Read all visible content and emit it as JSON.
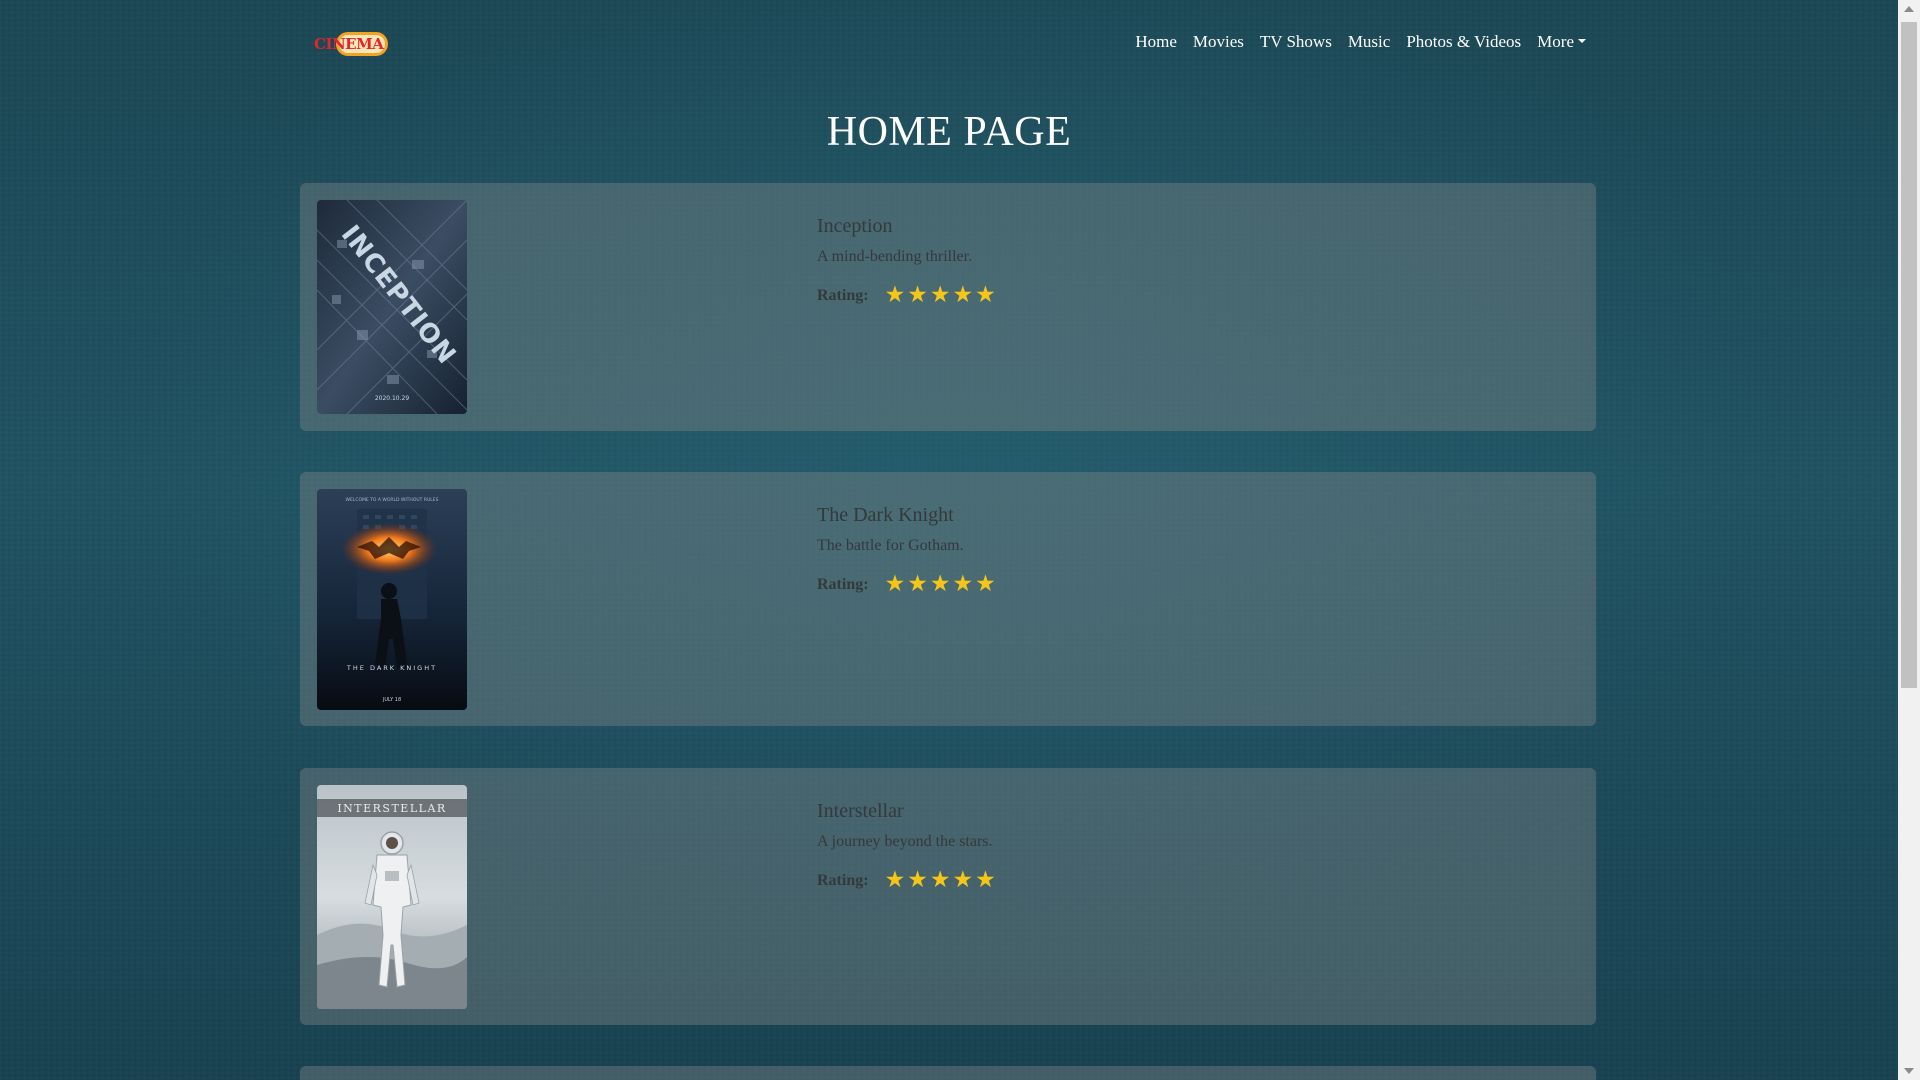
{
  "brand": {
    "logo_text": "CINEMA"
  },
  "nav": {
    "items": [
      {
        "label": "Home"
      },
      {
        "label": "Movies"
      },
      {
        "label": "TV Shows"
      },
      {
        "label": "Music"
      },
      {
        "label": "Photos & Videos"
      }
    ],
    "more_label": "More"
  },
  "page": {
    "title": "HOME PAGE"
  },
  "movies": [
    {
      "title": "Inception",
      "description": "A mind-bending thriller.",
      "rating_label": "Rating:",
      "rating": 5,
      "poster_text": "INCEPTION"
    },
    {
      "title": "The Dark Knight",
      "description": "The battle for Gotham.",
      "rating_label": "Rating:",
      "rating": 5,
      "poster_text": "THE DARK KNIGHT"
    },
    {
      "title": "Interstellar",
      "description": "A journey beyond the stars.",
      "rating_label": "Rating:",
      "rating": 5,
      "poster_text": "INTERSTELLAR"
    }
  ],
  "colors": {
    "star": "#f5c518",
    "logo_red": "#e3242b",
    "logo_orange": "#f2a324"
  }
}
